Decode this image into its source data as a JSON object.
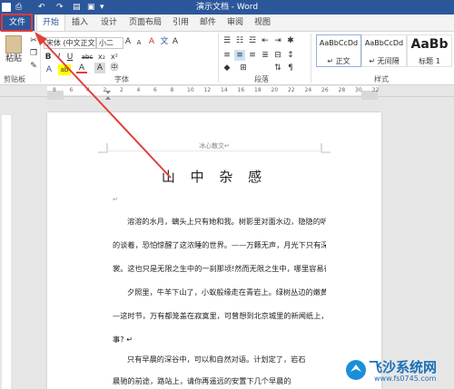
{
  "window": {
    "title": "演示文档 - Word"
  },
  "quick_access": {
    "undo": "↶",
    "redo": "↷",
    "save": "⎙"
  },
  "tabs": [
    {
      "label": "文件"
    },
    {
      "label": "开始"
    },
    {
      "label": "插入"
    },
    {
      "label": "设计"
    },
    {
      "label": "页面布局"
    },
    {
      "label": "引用"
    },
    {
      "label": "邮件"
    },
    {
      "label": "审阅"
    },
    {
      "label": "视图"
    }
  ],
  "ribbon": {
    "clipboard": {
      "paste": "粘贴",
      "group": "剪贴板"
    },
    "font": {
      "family": "宋体 (中文正文)",
      "size": "小二",
      "grow": "A",
      "shrink": "A",
      "clear": "A",
      "bold": "B",
      "italic": "I",
      "underline": "U",
      "strike": "abc",
      "sub": "x₂",
      "sup": "x²",
      "highlight": "ab",
      "color": "A",
      "group": "字体"
    },
    "paragraph": {
      "group": "段落"
    },
    "styles": {
      "group": "样式",
      "items": [
        {
          "preview": "AaBbCcDd",
          "name": "↵ 正文"
        },
        {
          "preview": "AaBbCcDd",
          "name": "↵ 无间隔"
        },
        {
          "preview": "AaBb",
          "name": "标题 1"
        }
      ]
    }
  },
  "ruler": {
    "marks": [
      "8",
      "6",
      "4",
      "2",
      "2",
      "4",
      "6",
      "8",
      "10",
      "12",
      "14",
      "16",
      "18",
      "20",
      "22",
      "24",
      "26",
      "28",
      "30",
      "32"
    ]
  },
  "document": {
    "header": "冰心散文↵",
    "title": "山 中 杂 感",
    "empty_mark": "↵",
    "lines": [
      {
        "text": "溶溶的水月，螭头上只有她和我。树影里对面水边，隐隐的听见水声和笑语。我们微微"
      },
      {
        "text": "的谈着，恐怕惊醒了这浓睡的世界。——万籁无声，月光下只有深碧的池水，玲珑雪白的衣"
      },
      {
        "text": "裳。这也只是无限之生中的一刹那顷!然而无限之生中，哪里容易得这样的一刹那顷! ↵"
      },
      {
        "text": "夕照里，牛羊下山了，小蚁般缘走在青岩上。绿树丛边的嫩黄叶子，也衬在红墙边。—"
      },
      {
        "text": "—这时节，万有都笼盖在寂寞里，可曾想到北京城里的新闻纸上，花花绿绿的都载的是什么"
      },
      {
        "text": "事? ↵"
      },
      {
        "text": "只有早晨的深谷中，可以和自然对语。计划定了，岩石"
      },
      {
        "text": "晨驰的前途，路站上，请你再遥远的安置下几个早晨的"
      }
    ]
  },
  "watermark": {
    "brand": "飞沙系统网",
    "url": "www.fs0745.com"
  },
  "colors": {
    "accent": "#2b579a",
    "arrow": "#e0403a",
    "highlight_box": "#e53935"
  }
}
